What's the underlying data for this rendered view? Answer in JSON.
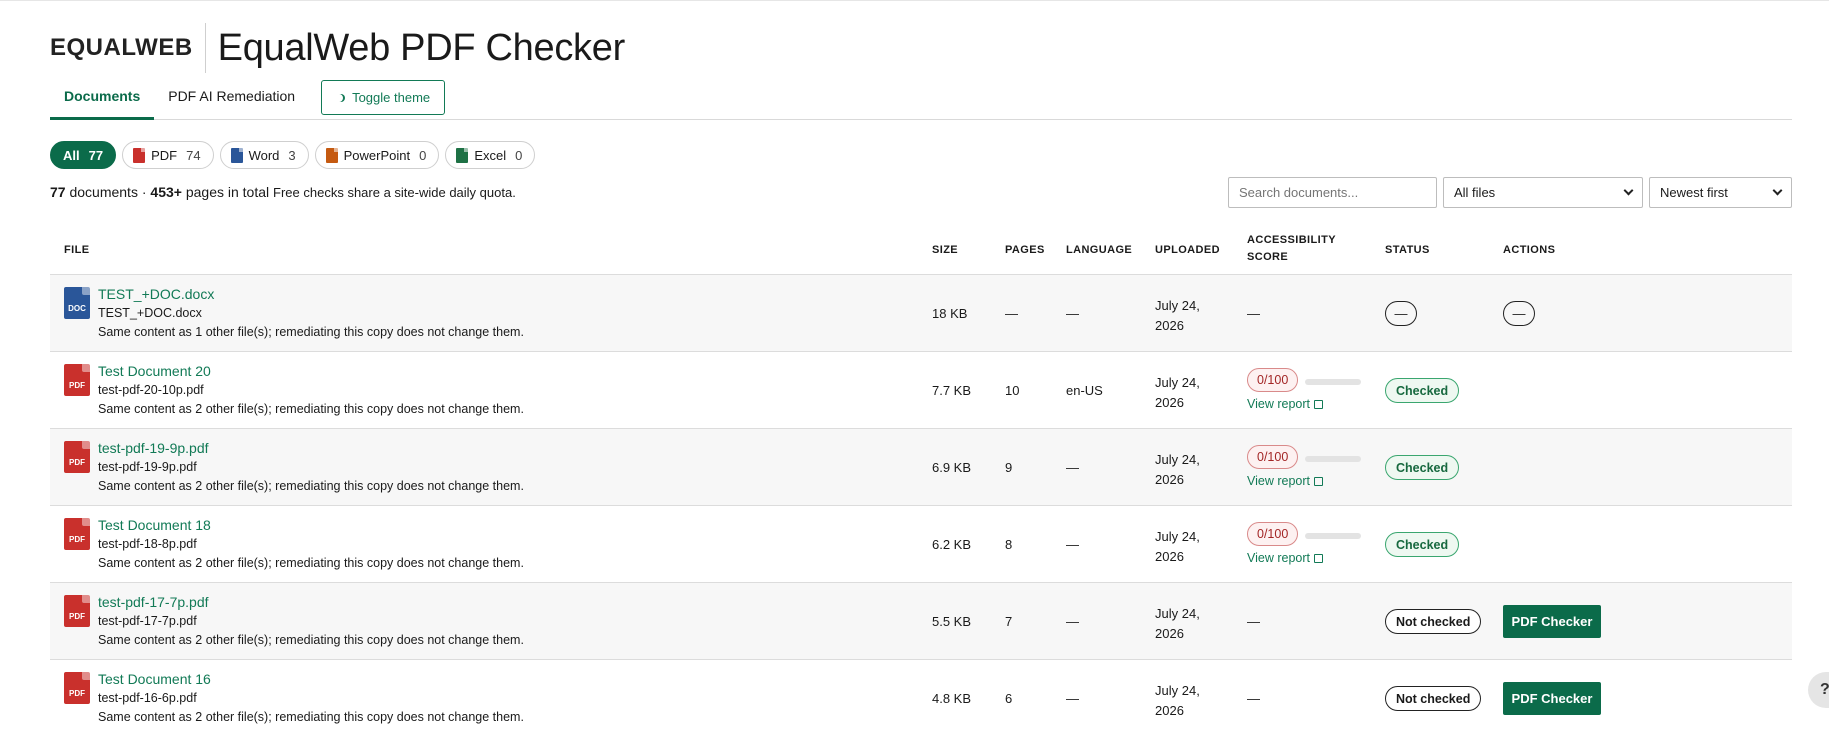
{
  "brand": {
    "logo_text": "EQUALWEB",
    "app_title": "EqualWeb PDF Checker"
  },
  "tabs": [
    {
      "label": "Documents",
      "active": true
    },
    {
      "label": "PDF AI Remediation",
      "active": false
    }
  ],
  "toggle_theme_label": "Toggle theme",
  "filters": [
    {
      "label": "All",
      "count": "77",
      "icon": null
    },
    {
      "label": "PDF",
      "count": "74",
      "icon": "pdf-file-icon"
    },
    {
      "label": "Word",
      "count": "3",
      "icon": "word-file-icon"
    },
    {
      "label": "PowerPoint",
      "count": "0",
      "icon": "powerpoint-file-icon"
    },
    {
      "label": "Excel",
      "count": "0",
      "icon": "excel-file-icon"
    }
  ],
  "summary": {
    "doc_count": "77",
    "doc_label": "documents ·",
    "page_count": "453+",
    "page_label": "pages in total",
    "quota_note": "Free checks share a site-wide daily quota."
  },
  "search": {
    "placeholder": "Search documents..."
  },
  "file_filter": {
    "selected": "All files"
  },
  "sort": {
    "selected": "Newest first"
  },
  "columns": {
    "file": "FILE",
    "size": "SIZE",
    "pages": "PAGES",
    "language": "LANGUAGE",
    "uploaded": "UPLOADED",
    "score_line1": "ACCESSIBILITY",
    "score_line2": "SCORE",
    "status": "STATUS",
    "actions": "ACTIONS"
  },
  "rows": [
    {
      "type": "DOC",
      "title": "TEST_+DOC.docx",
      "filename": "TEST_+DOC.docx",
      "note": "Same content as 1 other file(s); remediating this copy does not change them.",
      "size": "18 KB",
      "pages": "—",
      "language": "—",
      "uploaded_1": "July 24,",
      "uploaded_2": "2026",
      "score": "—",
      "view_report": "",
      "status": "—",
      "action": "—"
    },
    {
      "type": "PDF",
      "title": "Test Document 20",
      "filename": "test-pdf-20-10p.pdf",
      "note": "Same content as 2 other file(s); remediating this copy does not change them.",
      "size": "7.7 KB",
      "pages": "10",
      "language": "en-US",
      "uploaded_1": "July 24,",
      "uploaded_2": "2026",
      "score": "0/100",
      "view_report": "View report",
      "status": "Checked",
      "action": ""
    },
    {
      "type": "PDF",
      "title": "test-pdf-19-9p.pdf",
      "filename": "test-pdf-19-9p.pdf",
      "note": "Same content as 2 other file(s); remediating this copy does not change them.",
      "size": "6.9 KB",
      "pages": "9",
      "language": "—",
      "uploaded_1": "July 24,",
      "uploaded_2": "2026",
      "score": "0/100",
      "view_report": "View report",
      "status": "Checked",
      "action": ""
    },
    {
      "type": "PDF",
      "title": "Test Document 18",
      "filename": "test-pdf-18-8p.pdf",
      "note": "Same content as 2 other file(s); remediating this copy does not change them.",
      "size": "6.2 KB",
      "pages": "8",
      "language": "—",
      "uploaded_1": "July 24,",
      "uploaded_2": "2026",
      "score": "0/100",
      "view_report": "View report",
      "status": "Checked",
      "action": ""
    },
    {
      "type": "PDF",
      "title": "test-pdf-17-7p.pdf",
      "filename": "test-pdf-17-7p.pdf",
      "note": "Same content as 2 other file(s); remediating this copy does not change them.",
      "size": "5.5 KB",
      "pages": "7",
      "language": "—",
      "uploaded_1": "July 24,",
      "uploaded_2": "2026",
      "score": "—",
      "view_report": "",
      "status": "Not checked",
      "action": "PDF Checker"
    },
    {
      "type": "PDF",
      "title": "Test Document 16",
      "filename": "test-pdf-16-6p.pdf",
      "note": "Same content as 2 other file(s); remediating this copy does not change them.",
      "size": "4.8 KB",
      "pages": "6",
      "language": "—",
      "uploaded_1": "July 24,",
      "uploaded_2": "2026",
      "score": "—",
      "view_report": "",
      "status": "Not checked",
      "action": "PDF Checker"
    }
  ],
  "help_label": "?"
}
